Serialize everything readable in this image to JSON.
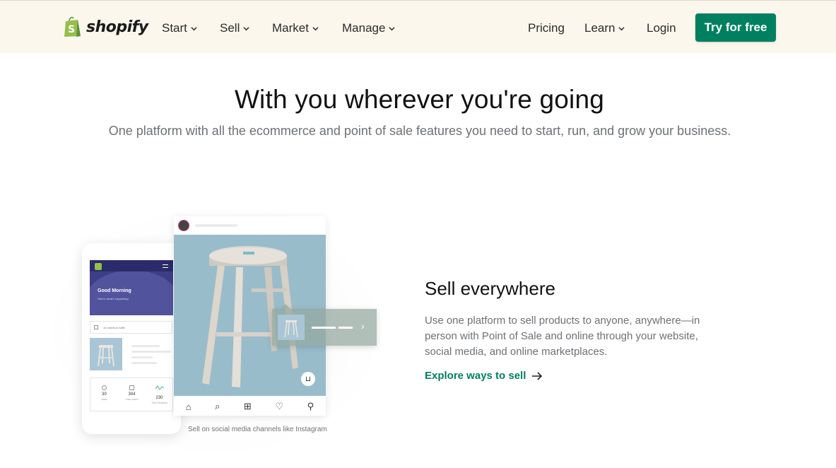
{
  "nav": {
    "logo_text": "shopify",
    "items": [
      {
        "label": "Start"
      },
      {
        "label": "Sell"
      },
      {
        "label": "Market"
      },
      {
        "label": "Manage"
      }
    ],
    "pricing": "Pricing",
    "learn": "Learn",
    "login": "Login",
    "cta": "Try for free"
  },
  "hero": {
    "title": "With you wherever you're going",
    "subtitle": "One platform with all the ecommerce and point of sale features you need to start, run, and grow your business."
  },
  "illustration": {
    "phone": {
      "greeting": "Good Morning",
      "greeting_sub": "Here's what's happening",
      "orders_label": "14 orders to fulfill",
      "stats": [
        {
          "value": "30",
          "label": "Sales",
          "icon": "dollar-icon"
        },
        {
          "value": "304",
          "label": "Total orders",
          "icon": "box-icon"
        },
        {
          "value": "230",
          "label": "Total Sessions",
          "icon": "activity-icon"
        }
      ]
    },
    "caption": "Sell on social media channels like Instagram"
  },
  "feature": {
    "title": "Sell everywhere",
    "description": "Use one platform to sell products to anyone, anywhere—in person with Point of Sale and online through your website, social media, and online marketplaces.",
    "link": "Explore ways to sell"
  },
  "colors": {
    "brand_green": "#008060",
    "nav_bg": "#fbf7ed",
    "logo_green": "#95bf47"
  }
}
